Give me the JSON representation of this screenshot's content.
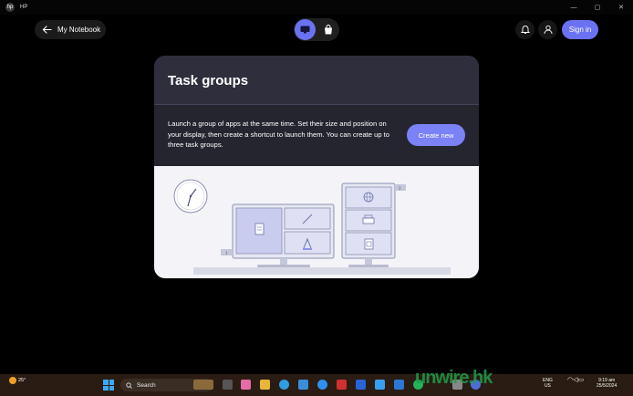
{
  "window": {
    "title": "HP"
  },
  "header": {
    "back_label": "My Notebook",
    "sign_in_label": "Sign in"
  },
  "card": {
    "title": "Task groups",
    "description": "Launch a group of apps at the same time. Set their size and position on your display, then create a shortcut to launch them. You can create up to three task groups.",
    "create_label": "Create new",
    "badges": [
      "1",
      "2"
    ]
  },
  "taskbar": {
    "weather_temp": "25°",
    "search_label": "Search",
    "lang_line1": "ENG",
    "lang_line2": "US",
    "time": "9:19 am",
    "date": "25/5/2024"
  },
  "watermark": "unwire.hk",
  "colors": {
    "accent": "#6b72f2",
    "button": "#7b82f6",
    "card_bg": "#2d2d3b",
    "illus_bg": "#f4f4f8"
  }
}
